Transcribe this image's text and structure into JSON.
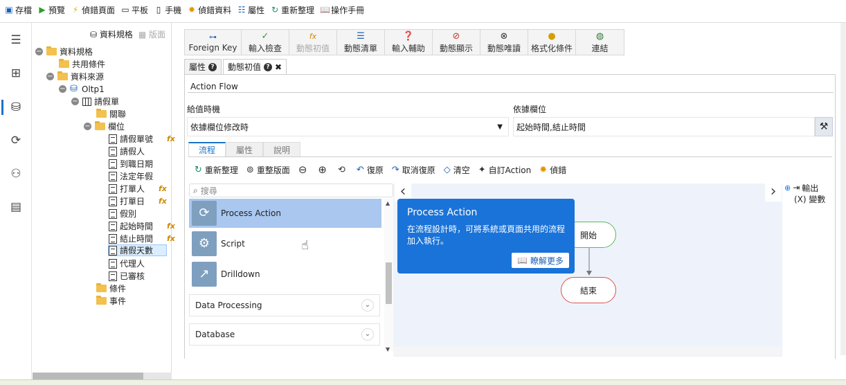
{
  "toolbar": {
    "items": [
      {
        "icon": "save-icon",
        "label": "存檔"
      },
      {
        "icon": "play-icon",
        "label": "預覽"
      },
      {
        "icon": "lightning-icon",
        "label": "偵錯頁面"
      },
      {
        "icon": "tablet-icon",
        "label": "平板"
      },
      {
        "icon": "phone-icon",
        "label": "手機"
      },
      {
        "icon": "bug-icon",
        "label": "偵錯資料"
      },
      {
        "icon": "properties-icon",
        "label": "屬性"
      },
      {
        "icon": "refresh-icon",
        "label": "重新整理"
      },
      {
        "icon": "book-icon",
        "label": "操作手冊"
      }
    ]
  },
  "tree": {
    "header": {
      "schema": "資料規格",
      "layout": "版面"
    },
    "nodes": [
      {
        "label": "資料規格"
      },
      {
        "label": "共用條件"
      },
      {
        "label": "資料來源"
      },
      {
        "label": "Oltp1"
      },
      {
        "label": "請假單"
      },
      {
        "label": "關聯"
      },
      {
        "label": "欄位"
      },
      {
        "label": "請假單號"
      },
      {
        "label": "請假人"
      },
      {
        "label": "到職日期"
      },
      {
        "label": "法定年假"
      },
      {
        "label": "打單人"
      },
      {
        "label": "打單日"
      },
      {
        "label": "假別"
      },
      {
        "label": "起始時間"
      },
      {
        "label": "結止時間"
      },
      {
        "label": "請假天數"
      },
      {
        "label": "代理人"
      },
      {
        "label": "已審核"
      },
      {
        "label": "條件"
      },
      {
        "label": "事件"
      }
    ],
    "fx": "fx"
  },
  "ribbon": [
    {
      "icon": "key-icon",
      "label": "Foreign Key"
    },
    {
      "icon": "check-icon",
      "label": "輸入檢查"
    },
    {
      "icon": "fx-icon",
      "label": "動態初值"
    },
    {
      "icon": "list-icon",
      "label": "動態清單"
    },
    {
      "icon": "help-icon",
      "label": "輸入輔助"
    },
    {
      "icon": "eye-off-icon",
      "label": "動態顯示"
    },
    {
      "icon": "readonly-icon",
      "label": "動態唯讀"
    },
    {
      "icon": "format-icon",
      "label": "格式化條件"
    },
    {
      "icon": "link-icon",
      "label": "連結"
    }
  ],
  "tabs": {
    "properties": "屬性",
    "dynamic_init": "動態初值"
  },
  "flow_title": "Action Flow",
  "trigger": {
    "label": "給值時機",
    "value": "依據欄位修改時"
  },
  "depends": {
    "label": "依據欄位",
    "value": "起始時間,結止時間"
  },
  "subtabs": [
    "流程",
    "屬性",
    "說明"
  ],
  "flow_tools": [
    {
      "icon": "refresh-icon",
      "label": "重新整理"
    },
    {
      "icon": "layout-icon",
      "label": "重整版面"
    },
    {
      "icon": "zoom-out-icon",
      "label": ""
    },
    {
      "icon": "zoom-in-icon",
      "label": ""
    },
    {
      "icon": "fit-icon",
      "label": ""
    },
    {
      "icon": "undo-icon",
      "label": "復原"
    },
    {
      "icon": "redo-icon",
      "label": "取消復原"
    },
    {
      "icon": "eraser-icon",
      "label": "清空"
    },
    {
      "icon": "custom-icon",
      "label": "自訂Action"
    },
    {
      "icon": "debug-icon",
      "label": "偵錯"
    }
  ],
  "search_placeholder": "搜尋",
  "actions": [
    {
      "label": "Process Action"
    },
    {
      "label": "Script"
    },
    {
      "label": "Drilldown"
    }
  ],
  "groups": [
    {
      "label": "Data Processing"
    },
    {
      "label": "Database"
    }
  ],
  "tooltip": {
    "title": "Process Action",
    "desc": "在流程設計時，可將系統或頁面共用的流程加入執行。",
    "button": "瞭解更多"
  },
  "nodes": {
    "start": "開始",
    "end": "結束"
  },
  "right_pane": {
    "output": "輸出",
    "variables": "(X) 變數"
  },
  "colors": {
    "accent": "#1a73d8",
    "start_border": "#5cb85c",
    "end_border": "#d9534f"
  }
}
